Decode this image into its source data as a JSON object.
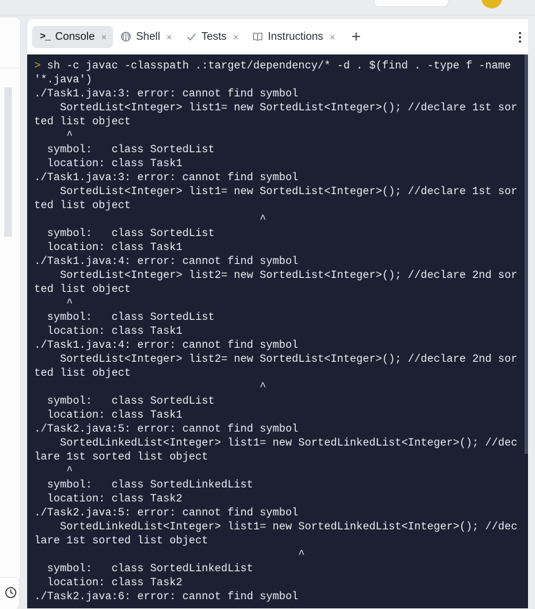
{
  "window": {
    "background_color": "#ebecef",
    "console_background": "#1b2132",
    "accent_color": "#c49a25",
    "active_tab_background": "#e6e7ea"
  },
  "header": {
    "avatar_color": "#e3b51f",
    "menu_glyph": "⋮",
    "overflow_glyph": "⋯"
  },
  "left_panel": {
    "menu_dot": "•",
    "clock_label": "history-clock"
  },
  "tabs": {
    "items": [
      {
        "label": "Console",
        "icon": "prompt-icon",
        "icon_glyph": ">_",
        "active": true,
        "close_glyph": "×"
      },
      {
        "label": "Shell",
        "icon": "seashell-icon",
        "active": false,
        "close_glyph": "×"
      },
      {
        "label": "Tests",
        "icon": "checkmark-icon",
        "active": false,
        "close_glyph": "×"
      },
      {
        "label": "Instructions",
        "icon": "book-icon",
        "active": false,
        "close_glyph": "×"
      }
    ],
    "add_label": "+",
    "menu_label": "⋮"
  },
  "console": {
    "prompt_symbol": ">",
    "command": "sh -c javac -classpath .:target/dependency/* -d . $(find . -type f -name '*.java')",
    "output": "./Task1.java:3: error: cannot find symbol\n    SortedList<Integer> list1= new SortedList<Integer>(); //declare 1st sorted list object\n     ^\n  symbol:   class SortedList\n  location: class Task1\n./Task1.java:3: error: cannot find symbol\n    SortedList<Integer> list1= new SortedList<Integer>(); //declare 1st sorted list object\n                                   ^\n  symbol:   class SortedList\n  location: class Task1\n./Task1.java:4: error: cannot find symbol\n    SortedList<Integer> list2= new SortedList<Integer>(); //declare 2nd sorted list object\n     ^\n  symbol:   class SortedList\n  location: class Task1\n./Task1.java:4: error: cannot find symbol\n    SortedList<Integer> list2= new SortedList<Integer>(); //declare 2nd sorted list object\n                                   ^\n  symbol:   class SortedList\n  location: class Task1\n./Task2.java:5: error: cannot find symbol\n    SortedLinkedList<Integer> list1= new SortedLinkedList<Integer>(); //declare 1st sorted list object\n     ^\n  symbol:   class SortedLinkedList\n  location: class Task2\n./Task2.java:5: error: cannot find symbol\n    SortedLinkedList<Integer> list1= new SortedLinkedList<Integer>(); //declare 1st sorted list object\n                                         ^\n  symbol:   class SortedLinkedList\n  location: class Task2\n./Task2.java:6: error: cannot find symbol",
    "wrap_columns": 75
  }
}
